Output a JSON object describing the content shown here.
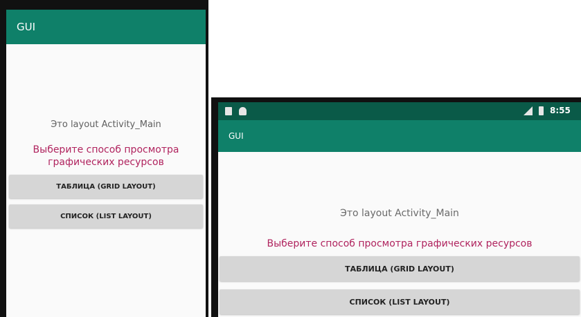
{
  "colors": {
    "primary": "#0f8069",
    "status_bar": "#0a5a48",
    "prompt_text": "#b0235e",
    "button_bg": "#d6d6d6"
  },
  "portrait": {
    "app_title": "GUI",
    "caption": "Это layout Activity_Main",
    "prompt": "Выберите способ просмотра графических ресурсов",
    "grid_button": "ТАБЛИЦА (GRID LAYOUT)",
    "list_button": "СПИСОК (LIST LAYOUT)"
  },
  "landscape": {
    "status_bar": {
      "icons": [
        "sd-card-icon",
        "android-debug-icon",
        "signal-icon",
        "battery-icon"
      ],
      "time": "8:55"
    },
    "app_title": "GUI",
    "caption": "Это layout Activity_Main",
    "prompt": "Выберите способ просмотра графических ресурсов",
    "grid_button": "ТАБЛИЦА (GRID LAYOUT)",
    "list_button": "СПИСОК (LIST LAYOUT)"
  }
}
